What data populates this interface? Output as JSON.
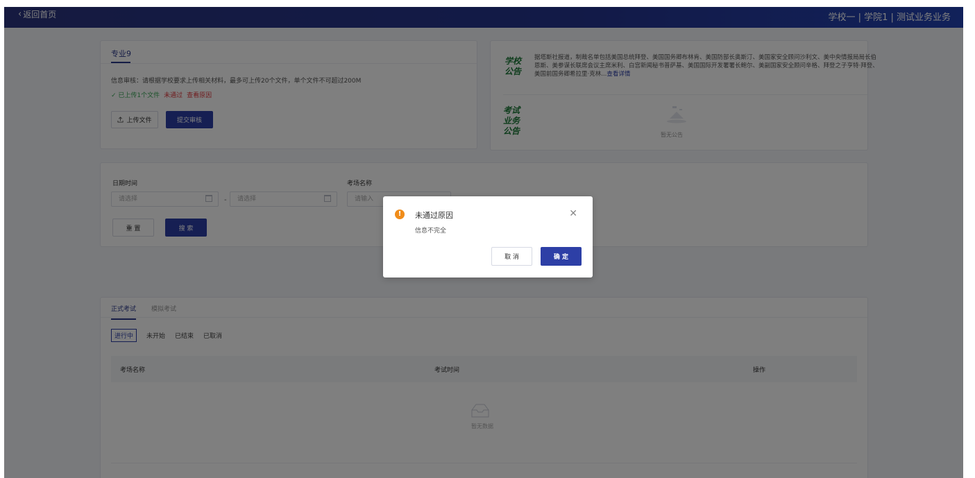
{
  "topbar": {
    "back_label": "返回首页",
    "org_path": "学校一 | 学院1 | 测试业务业务"
  },
  "major": {
    "title": "专业9",
    "audit_note": "信息审核：请根据学校要求上传相关材料，最多可上传20个文件，单个文件不可超过200M",
    "uploaded_status": "✓ 已上传1个文件",
    "result_status": "未通过",
    "reason_link": "查看原因",
    "upload_button": "上传文件",
    "submit_button": "提交审核"
  },
  "notices": {
    "school_label": "学校公告",
    "school_text": "据塔斯社报道，制裁名单包括美国总统拜登、美国国务卿布林肯、美国防部长奥斯汀、美国家安全顾问沙利文、美中央情报局局长伯恩斯、美参谋长联席会议主席米利、白宫新闻秘书普萨基、美国国际开发署署长鲍尔、美副国家安全顾问辛格、拜登之子亨特·拜登、美国前国务卿希拉里·克林...",
    "school_more": "查看详情",
    "exam_label": "考试业务公告",
    "exam_empty": "暂无公告"
  },
  "search": {
    "date_label": "日期时间",
    "date_start_placeholder": "请选择",
    "date_end_placeholder": "请选择",
    "date_separator": "-",
    "room_label": "考场名称",
    "room_placeholder": "请输入",
    "reset_button": "重 置",
    "search_button": "搜 索"
  },
  "exams": {
    "tabs": [
      "正式考试",
      "模拟考试"
    ],
    "active_tab": 0,
    "status_tabs": [
      "进行中",
      "未开始",
      "已结束",
      "已取消"
    ],
    "active_status": 0,
    "columns": [
      "考场名称",
      "考试时间",
      "操作"
    ],
    "empty_text": "暂无数据"
  },
  "dialog": {
    "title": "未通过原因",
    "message": "信息不完全",
    "cancel_label": "取 消",
    "ok_label": "确 定",
    "icon": "warning-icon"
  },
  "colors": {
    "primary": "#2d3fa6",
    "notice_green": "#1f7a3a",
    "error": "#e0393e",
    "success": "#3aa757",
    "warning": "#f08c1a"
  }
}
